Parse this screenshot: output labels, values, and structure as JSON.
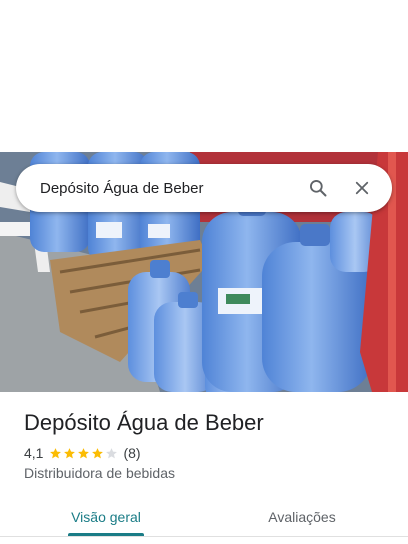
{
  "search": {
    "query": "Depósito Água de Beber",
    "search_icon": "search-icon",
    "close_icon": "close-icon"
  },
  "place": {
    "name": "Depósito Água de Beber",
    "rating": "4,1",
    "rating_value": 4.1,
    "max_stars": 5,
    "review_count": "(8)",
    "category": "Distribuidora de bebidas"
  },
  "tabs": [
    {
      "label": "Visão geral",
      "active": true
    },
    {
      "label": "Avaliações",
      "active": false
    }
  ],
  "colors": {
    "accent": "#1a7c86",
    "star": "#fbbc04",
    "star_empty": "#dadce0"
  }
}
